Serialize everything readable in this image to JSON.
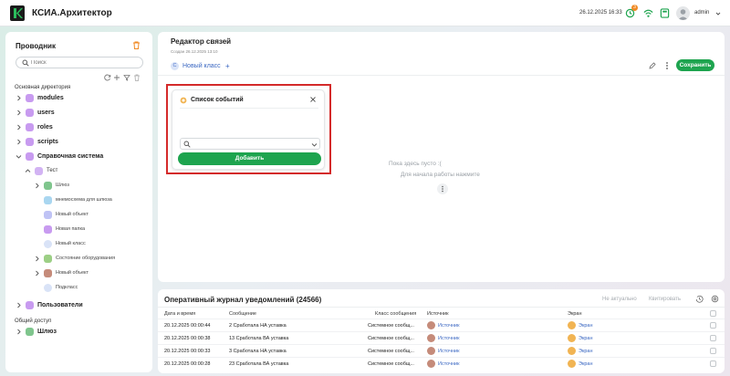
{
  "header": {
    "app_title": "КСИА.Архитектор",
    "datetime": "26.12.2025 16:33",
    "notifications_count": "3",
    "user": "admin"
  },
  "sidebar": {
    "title": "Проводник",
    "search_placeholder": "Поиск",
    "main_section_label": "Основная директория",
    "items": [
      {
        "label": "modules"
      },
      {
        "label": "users"
      },
      {
        "label": "roles"
      },
      {
        "label": "scripts"
      },
      {
        "label": "Справочная система"
      },
      {
        "label": "Тест"
      },
      {
        "label": "Шлюз"
      },
      {
        "label": "мнемосхема для шлюза"
      },
      {
        "label": "Новый объект"
      },
      {
        "label": "Новая папка"
      },
      {
        "label": "Новый класс"
      },
      {
        "label": "Состояние оборудования"
      },
      {
        "label": "Новый объект"
      },
      {
        "label": "Подкласс"
      },
      {
        "label": "Пользователи"
      }
    ],
    "shared_section_label": "Общий доступ",
    "shared_items": [
      {
        "label": "Шлюз"
      }
    ]
  },
  "editor": {
    "title": "Редактор связей",
    "created": "Создан 26.12.2025 13:10",
    "class_icon": "С",
    "class_label": "Новый класс",
    "add_symbol": "+",
    "save_label": "Сохранить",
    "empty_line1": "Пока здесь пусто :(",
    "empty_line2": "Для начала работы нажмите"
  },
  "event_popup": {
    "title": "Список событий",
    "add_label": "Добавить"
  },
  "journal": {
    "title": "Оперативный журнал уведомлений (24566)",
    "btn_not_actual": "Не актуально",
    "btn_quote": "Квитировать",
    "columns": [
      "Дата и время",
      "Сообщение",
      "Класс сообщения",
      "Источник",
      "Экран"
    ],
    "rows": [
      {
        "datetime": "20.12.2025 00:00:44",
        "message": "2 Сработала НА уставка",
        "class": "Системное сообщ...",
        "source": "Источник",
        "screen": "Экран"
      },
      {
        "datetime": "20.12.2025 00:00:38",
        "message": "13 Сработала ВА уставка",
        "class": "Системное сообщ...",
        "source": "Источник",
        "screen": "Экран"
      },
      {
        "datetime": "20.12.2025 00:00:33",
        "message": "3 Сработала НА уставка",
        "class": "Системное сообщ...",
        "source": "Источник",
        "screen": "Экран"
      },
      {
        "datetime": "20.12.2025 00:00:28",
        "message": "23 Сработала ВА уставка",
        "class": "Системное сообщ...",
        "source": "Источник",
        "screen": "Экран"
      }
    ]
  },
  "colors": {
    "accent_green": "#1ea44f",
    "link_blue": "#3a67c2",
    "folder_purple": "#b57be6",
    "highlight_red": "#d42a2a"
  }
}
